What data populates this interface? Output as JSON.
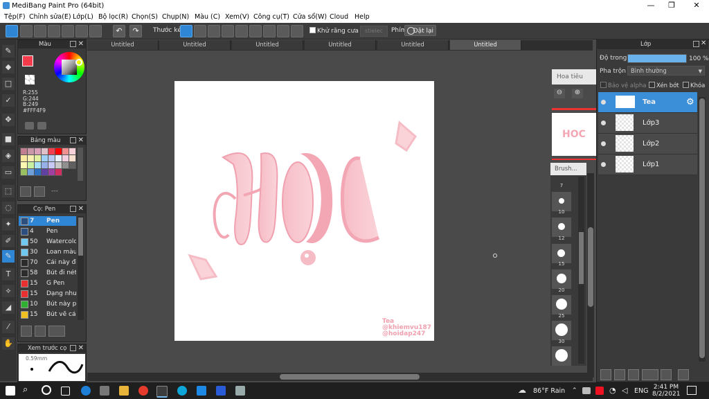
{
  "window": {
    "title": "MediBang Paint Pro (64bit)"
  },
  "menu": [
    "Tệp(F)",
    "Chỉnh sửa(E)",
    "Lớp(L)",
    "Bộ lọc(R)",
    "Chọn(S)",
    "Chụp(N)",
    "Màu (C)",
    "Xem(V)",
    "Công cụ(T)",
    "Cửa sổ(W)",
    "Cloud",
    "Help"
  ],
  "toolbar": {
    "ruler_label": "Thước kẻ",
    "antialias_label": "Khử răng cưa",
    "antialias_value": "stielec",
    "key_label": "Phím",
    "reset_label": "Đặt lại"
  },
  "color_panel": {
    "title": "Màu",
    "r": "R:255",
    "g": "G:244",
    "b": "B:249",
    "hex": "#FFF4F9",
    "foreground": "#f43c4c",
    "hue_ring": "rainbow"
  },
  "palette_panel": {
    "title": "Bảng màu",
    "colors": [
      "#c08090",
      "#c898a8",
      "#d8a0b8",
      "#e0c0c8",
      "#f04050",
      "#ff0000",
      "#f09090",
      "#f8d0d8",
      "#f8e8a0",
      "#f8f0b0",
      "#e0f0a0",
      "#a0d0f8",
      "#b8c8f0",
      "#e8f0f8",
      "#f0d0e0",
      "#f8e0d0",
      "#fff8b0",
      "#c8f0a0",
      "#a8e0f8",
      "#98b0e8",
      "#c8c8f8",
      "#c8c8c8",
      "#909090",
      "#606060",
      "#98c060",
      "#70a0d8",
      "#3070c0",
      "#6040a0",
      "#a040a0",
      "#d03060"
    ],
    "extra": "---"
  },
  "brush_panel": {
    "title": "Cọ: Pen",
    "items": [
      {
        "size": "7",
        "name": "Pen",
        "color": "#2d4f80"
      },
      {
        "size": "4",
        "name": "Pen",
        "color": "#2d4f80"
      },
      {
        "size": "50",
        "name": "Watercolor",
        "color": "#6ec8f0"
      },
      {
        "size": "30",
        "name": "Loan màu",
        "color": "#6ec8f0"
      },
      {
        "size": "70",
        "name": "Cái này để",
        "color": "#2b2b2b"
      },
      {
        "size": "58",
        "name": "Bút đi nét",
        "color": "#2b2b2b"
      },
      {
        "size": "15",
        "name": "G Pen",
        "color": "#e83030"
      },
      {
        "size": "15",
        "name": "Dạng như",
        "color": "#e83030"
      },
      {
        "size": "10",
        "name": "Bút này p",
        "color": "#30b030"
      },
      {
        "size": "15",
        "name": "Bút vẽ cả",
        "color": "#f0c020"
      }
    ]
  },
  "preview_panel": {
    "title": "Xem trước cọ",
    "size": "0.59mm"
  },
  "tabs": [
    "Untitled",
    "Untitled",
    "Untitled",
    "Untitled",
    "Untitled",
    "Untitled"
  ],
  "canvas": {
    "artwork_text": "HOC",
    "signature": [
      "Tea",
      "@khiemvu187",
      "@hoidap247"
    ]
  },
  "navigator": {
    "label": "Hoa tiêu"
  },
  "brush_size_panel": {
    "label": "Brush...",
    "sizes": [
      "7",
      "10",
      "12",
      "15",
      "20",
      "25",
      "30"
    ]
  },
  "layer_panel": {
    "title": "Lớp",
    "opacity_label": "Độ trong",
    "opacity_value": "100 %",
    "opacity_fraction": 1.0,
    "blend_label": "Pha trộn",
    "blend_value": "Bình thường",
    "protect_alpha": "Bảo vệ alpha",
    "clipping": "Xén bớt",
    "lock": "Khóa",
    "layers": [
      {
        "name": "Tea",
        "selected": true
      },
      {
        "name": "Lớp3",
        "selected": false
      },
      {
        "name": "Lớp2",
        "selected": false
      },
      {
        "name": "Lớp1",
        "selected": false
      }
    ]
  },
  "taskbar": {
    "weather": "86°F  Rain",
    "language": "ENG",
    "time": "2:41 PM",
    "date": "8/2/2021"
  }
}
